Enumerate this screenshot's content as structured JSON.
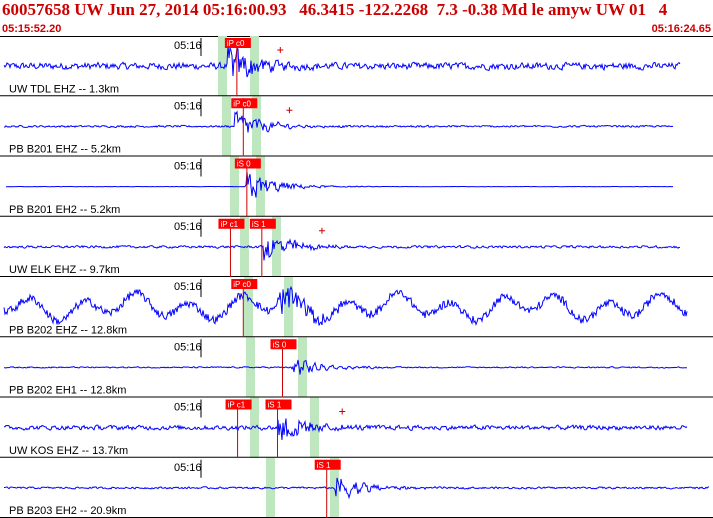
{
  "header": {
    "title": "60057658 UW Jun 27, 2014 05:16:00.93   46.3415 -122.2268  7.3 -0.38 Md le amyw UW 01   4",
    "start_time": "05:15:52.20",
    "end_time": "05:16:24.65"
  },
  "colors": {
    "header_text": "#cc0000",
    "trace": "#0000ff",
    "pick_box": "#ff0000",
    "pick_line": "#cc0000",
    "theoretical_band": "#bfe7bf",
    "separator": "#000000",
    "label_text": "#000000"
  },
  "traces": [
    {
      "label": "UW TDL EHZ -- 1.3km",
      "minute_label": "05:16",
      "amplitude": 1.4,
      "noise": 0.9,
      "onset": 0.33,
      "picks": [
        {
          "label": "iP c0",
          "t": 0.321
        }
      ],
      "end": 0.96
    },
    {
      "label": "PB B201 EHZ -- 5.2km",
      "minute_label": "05:16",
      "amplitude": 1.0,
      "noise": 0.35,
      "onset": 0.34,
      "picks": [
        {
          "label": "iP c0",
          "t": 0.33
        }
      ],
      "end": 0.95
    },
    {
      "label": "PB B201 EH2 -- 5.2km",
      "minute_label": "05:16",
      "amplitude": 1.1,
      "noise": 0.05,
      "onset": 0.355,
      "picks": [
        {
          "label": "iS 0",
          "t": 0.335
        }
      ],
      "end": 0.95
    },
    {
      "label": "UW ELK EHZ -- 9.7km",
      "minute_label": "05:16",
      "amplitude": 1.1,
      "noise": 0.4,
      "onset": 0.38,
      "picks": [
        {
          "label": "iP c1",
          "t": 0.312
        },
        {
          "label": "iS 1",
          "t": 0.356
        }
      ],
      "end": 0.96
    },
    {
      "label": "PB B202 EHZ -- 12.8km",
      "minute_label": "05:16",
      "amplitude": 1.2,
      "noise": 1.7,
      "onset": 0.4,
      "picks": [
        {
          "label": "iP c0",
          "t": 0.33
        }
      ],
      "end": 0.97
    },
    {
      "label": "PB B202 EH1 -- 12.8km",
      "minute_label": "05:16",
      "amplitude": 0.7,
      "noise": 0.35,
      "onset": 0.42,
      "picks": [
        {
          "label": "iS 0",
          "t": 0.385
        }
      ],
      "end": 0.97
    },
    {
      "label": "UW KOS EHZ -- 13.7km",
      "minute_label": "05:16",
      "amplitude": 1.2,
      "noise": 0.7,
      "onset": 0.4,
      "picks": [
        {
          "label": "iP c1",
          "t": 0.322
        },
        {
          "label": "iS 1",
          "t": 0.378
        }
      ],
      "end": 0.97
    },
    {
      "label": "PB B203 EH2 -- 20.9km",
      "minute_label": "05:16",
      "amplitude": 1.0,
      "noise": 0.35,
      "onset": 0.48,
      "picks": [
        {
          "label": "iS 1",
          "t": 0.447
        }
      ],
      "end": 1.0
    }
  ]
}
